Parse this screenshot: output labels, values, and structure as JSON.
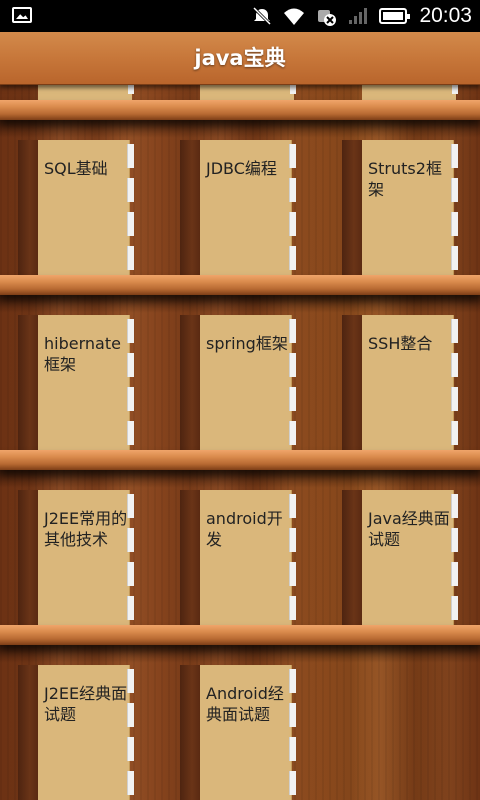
{
  "status_bar": {
    "time": "20:03",
    "icons": [
      "image-icon",
      "mute-icon",
      "wifi-icon",
      "sync-icon",
      "signal-icon",
      "battery-icon"
    ]
  },
  "header": {
    "title": "java宝典"
  },
  "shelves": [
    {
      "books": [
        {
          "label": "SQL基础"
        },
        {
          "label": "JDBC编程"
        },
        {
          "label": "Struts2框架"
        }
      ]
    },
    {
      "books": [
        {
          "label": "hibernate框架"
        },
        {
          "label": "spring框架"
        },
        {
          "label": "SSH整合"
        }
      ]
    },
    {
      "books": [
        {
          "label": "J2EE常用的其他技术"
        },
        {
          "label": "android开发"
        },
        {
          "label": "Java经典面试题"
        }
      ]
    },
    {
      "books": [
        {
          "label": "J2EE经典面试题"
        },
        {
          "label": "Android经典面试题"
        }
      ]
    }
  ],
  "colors": {
    "title_bar": "#c7773a",
    "book_cover": "#dab77b",
    "shelf_wood": "#8c4820"
  }
}
